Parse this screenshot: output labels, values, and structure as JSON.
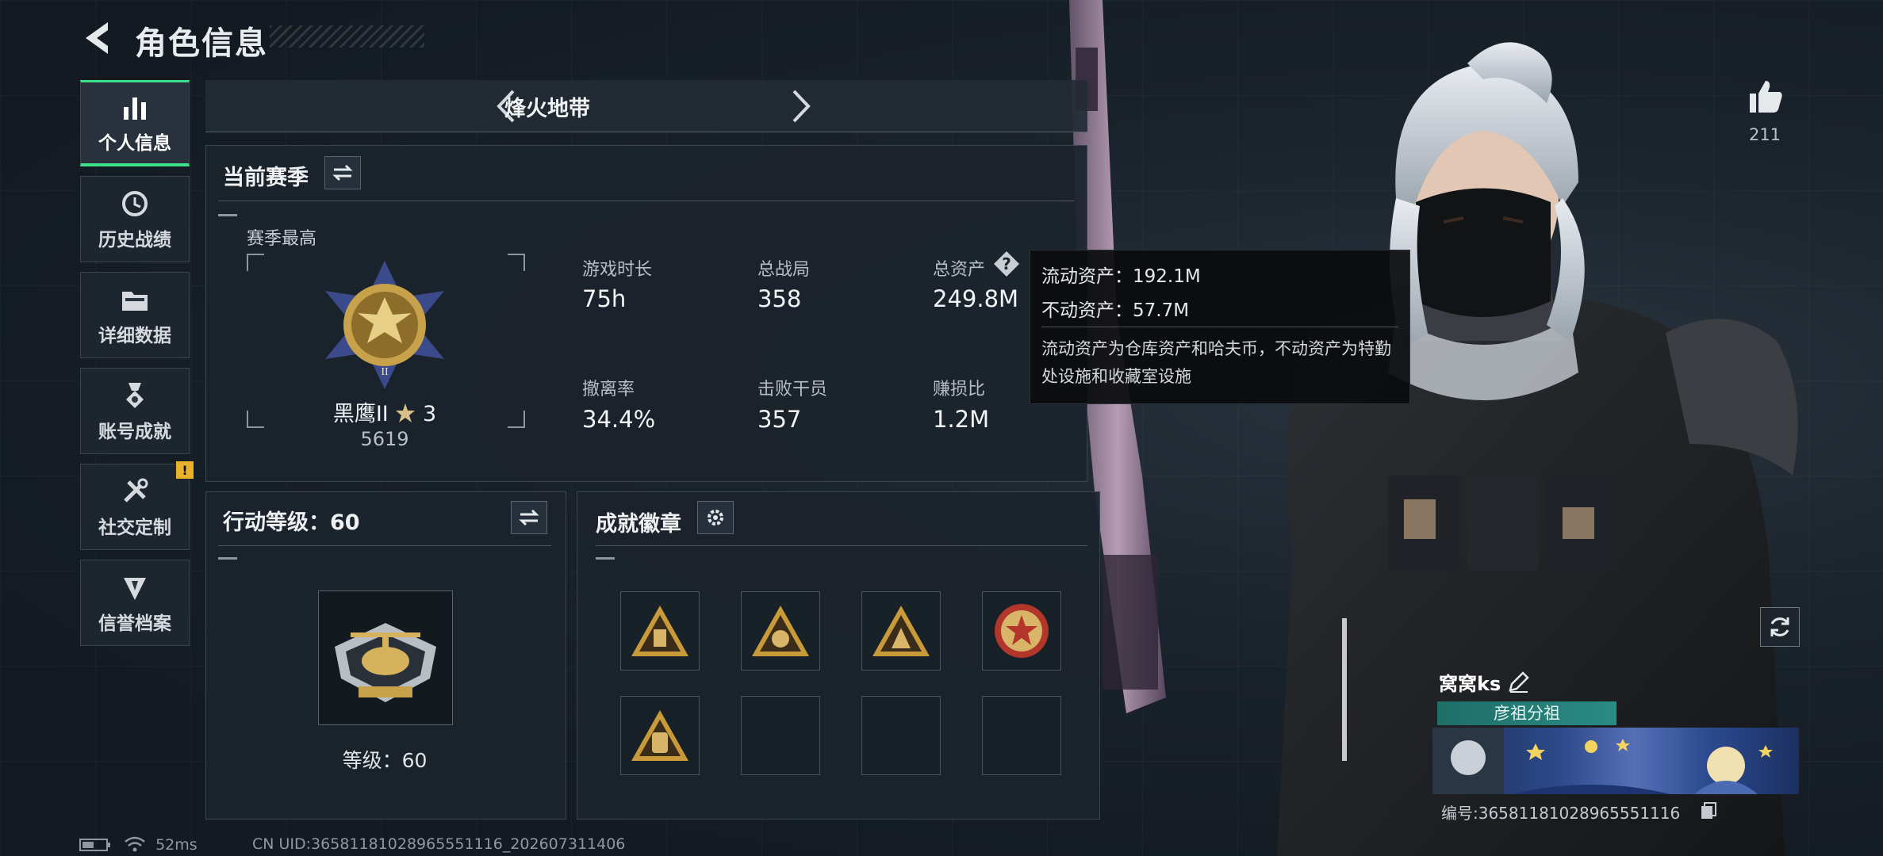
{
  "header": {
    "title": "角色信息"
  },
  "sidebar": {
    "items": [
      {
        "label": "个人信息",
        "icon": "bar-chart-icon",
        "active": true
      },
      {
        "label": "历史战绩",
        "icon": "history-icon"
      },
      {
        "label": "详细数据",
        "icon": "folder-icon"
      },
      {
        "label": "账号成就",
        "icon": "achievement-medal-icon"
      },
      {
        "label": "社交定制",
        "icon": "tools-icon",
        "badge": "!"
      },
      {
        "label": "信誉档案",
        "icon": "shield-icon"
      }
    ]
  },
  "mode": {
    "title": "烽火地带"
  },
  "season": {
    "title": "当前赛季",
    "best_label": "赛季最高",
    "rank_name": "黑鹰II",
    "rank_stars": "3",
    "rank_score": "5619",
    "stats": [
      {
        "label": "游戏时长",
        "value": "75h"
      },
      {
        "label": "总战局",
        "value": "358"
      },
      {
        "label": "总资产",
        "value": "249.8M"
      },
      {
        "label": "撤离率",
        "value": "34.4%"
      },
      {
        "label": "击败干员",
        "value": "357"
      },
      {
        "label": "赚损比",
        "value": "1.2M"
      }
    ]
  },
  "tooltip": {
    "liquid": "流动资产：192.1M",
    "fixed": "不动资产：57.7M",
    "desc": "流动资产为仓库资产和哈夫币，不动资产为特勤处设施和收藏室设施"
  },
  "action_level": {
    "title": "行动等级：60",
    "level_text": "等级：60"
  },
  "achievements": {
    "title": "成就徽章"
  },
  "profile": {
    "likes": "211",
    "player_name": "窝窝ks",
    "clan": "彦祖分祖",
    "player_id": "编号:36581181028965551116"
  },
  "status": {
    "ping": "52ms",
    "uid": "CN UID:36581181028965551116_202607311406"
  },
  "colors": {
    "accent": "#3fe08a",
    "warning": "#e8b32a",
    "gold": "#c8a24a"
  }
}
